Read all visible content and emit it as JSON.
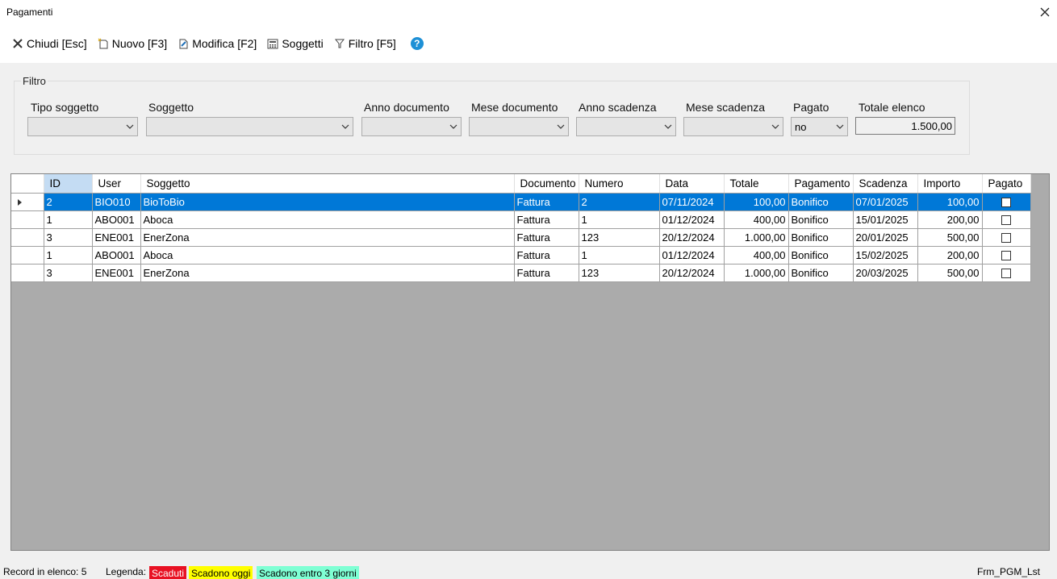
{
  "window": {
    "title": "Pagamenti"
  },
  "toolbar": {
    "close_label": "Chiudi [Esc]",
    "new_label": "Nuovo [F3]",
    "edit_label": "Modifica [F2]",
    "subjects_label": "Soggetti",
    "filter_label": "Filtro [F5]",
    "help_glyph": "?"
  },
  "filter": {
    "legend": "Filtro",
    "tipo_soggetto": {
      "label": "Tipo soggetto",
      "value": ""
    },
    "soggetto": {
      "label": "Soggetto",
      "value": ""
    },
    "anno_documento": {
      "label": "Anno documento",
      "value": ""
    },
    "mese_documento": {
      "label": "Mese documento",
      "value": ""
    },
    "anno_scadenza": {
      "label": "Anno scadenza",
      "value": ""
    },
    "mese_scadenza": {
      "label": "Mese scadenza",
      "value": ""
    },
    "pagato": {
      "label": "Pagato",
      "value": "no"
    },
    "totale": {
      "label": "Totale elenco",
      "value": "1.500,00"
    }
  },
  "grid": {
    "columns": [
      "ID",
      "User",
      "Soggetto",
      "Documento",
      "Numero",
      "Data",
      "Totale",
      "Pagamento",
      "Scadenza",
      "Importo",
      "Pagato"
    ],
    "rows": [
      {
        "id": "2",
        "user": "BIO010",
        "soggetto": "BioToBio",
        "documento": "Fattura",
        "numero": "2",
        "data": "07/11/2024",
        "totale": "100,00",
        "pagamento": "Bonifico",
        "scadenza": "07/01/2025",
        "importo": "100,00",
        "pagato": false
      },
      {
        "id": "1",
        "user": "ABO001",
        "soggetto": "Aboca",
        "documento": "Fattura",
        "numero": "1",
        "data": "01/12/2024",
        "totale": "400,00",
        "pagamento": "Bonifico",
        "scadenza": "15/01/2025",
        "importo": "200,00",
        "pagato": false
      },
      {
        "id": "3",
        "user": "ENE001",
        "soggetto": "EnerZona",
        "documento": "Fattura",
        "numero": "123",
        "data": "20/12/2024",
        "totale": "1.000,00",
        "pagamento": "Bonifico",
        "scadenza": "20/01/2025",
        "importo": "500,00",
        "pagato": false
      },
      {
        "id": "1",
        "user": "ABO001",
        "soggetto": "Aboca",
        "documento": "Fattura",
        "numero": "1",
        "data": "01/12/2024",
        "totale": "400,00",
        "pagamento": "Bonifico",
        "scadenza": "15/02/2025",
        "importo": "200,00",
        "pagato": false
      },
      {
        "id": "3",
        "user": "ENE001",
        "soggetto": "EnerZona",
        "documento": "Fattura",
        "numero": "123",
        "data": "20/12/2024",
        "totale": "1.000,00",
        "pagamento": "Bonifico",
        "scadenza": "20/03/2025",
        "importo": "500,00",
        "pagato": false
      }
    ]
  },
  "status": {
    "record_count": "Record in elenco: 5",
    "legend_label": "Legenda:",
    "legend_items": [
      {
        "label": "Scaduti",
        "color": "#e81123",
        "text_color": "#ffffff"
      },
      {
        "label": "Scadono oggi",
        "color": "#ffff00",
        "text_color": "#000000"
      },
      {
        "label": "Scadono entro 3 giorni",
        "color": "#7fffd4",
        "text_color": "#000000"
      }
    ],
    "form_name": "Frm_PGM_Lst"
  },
  "colors": {
    "selection": "#0078d7",
    "grid_background": "#ababab",
    "help_icon": "#1e90d6"
  }
}
